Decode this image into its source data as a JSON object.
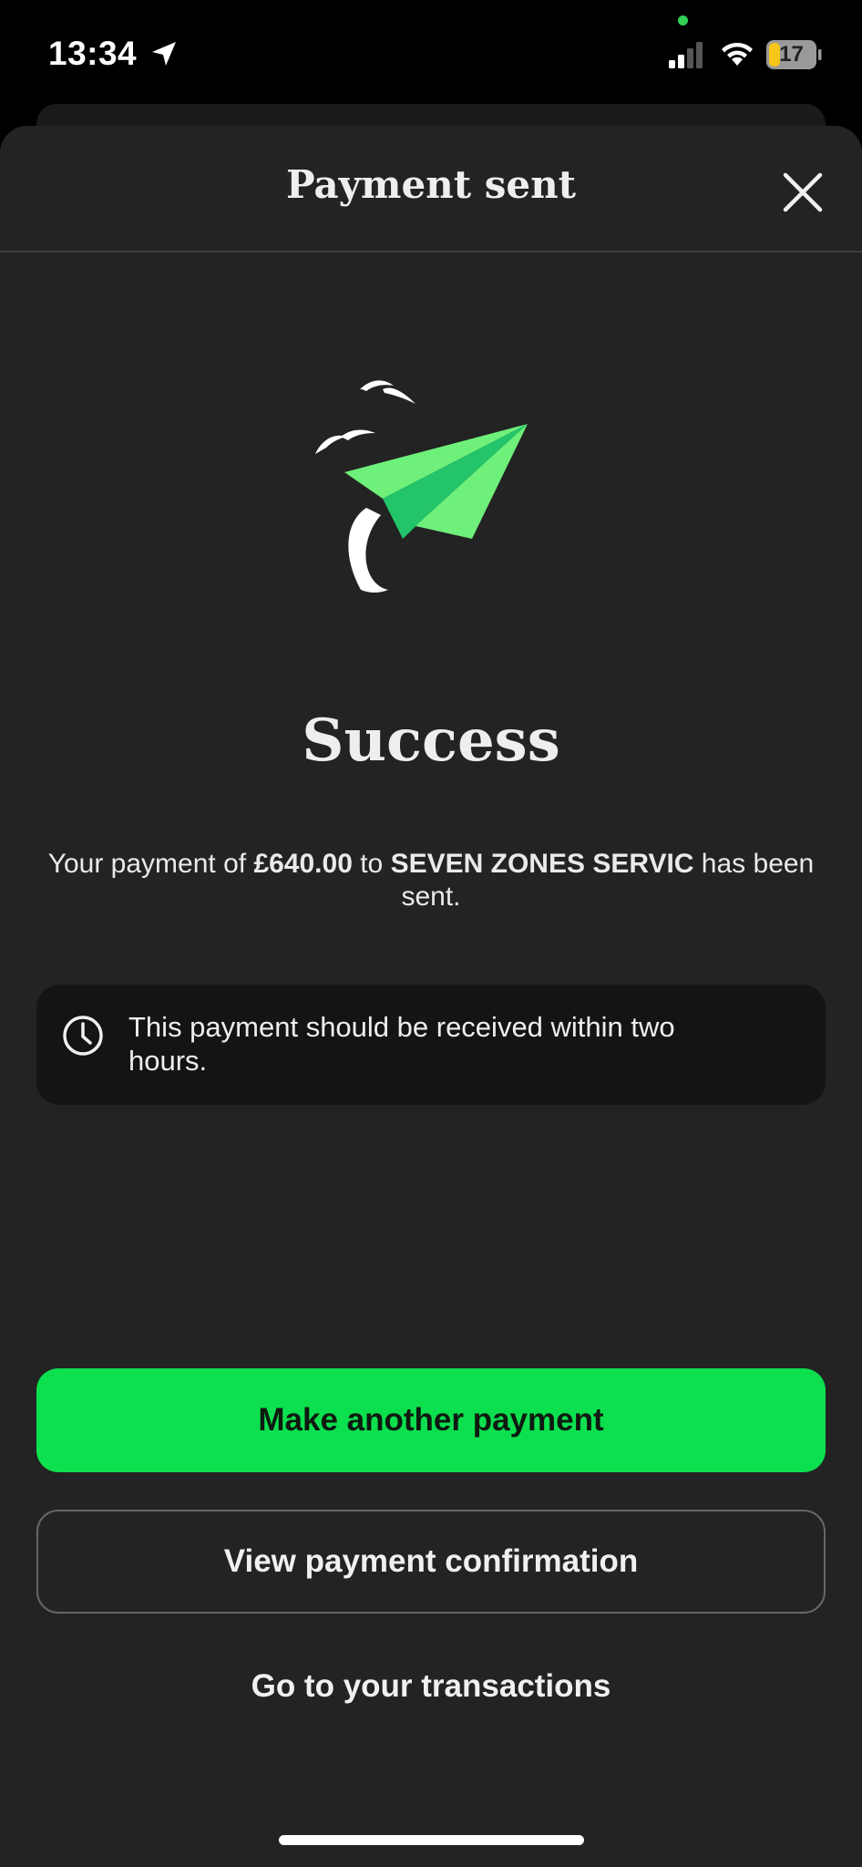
{
  "status_bar": {
    "time": "13:34",
    "battery": "17",
    "icons": [
      "location-arrow-icon",
      "signal-icon",
      "wifi-icon",
      "battery-icon"
    ]
  },
  "header": {
    "title": "Payment sent",
    "close_icon": "close-icon"
  },
  "illustration": {
    "icon": "paper-plane-icon",
    "colors": {
      "plane_light": "#6ef07a",
      "plane_mid": "#23c46a",
      "plane_dark": "#0f6b3a"
    }
  },
  "main": {
    "heading": "Success",
    "message": {
      "prefix": "Your payment of ",
      "amount": "£640.00",
      "middle": " to ",
      "payee": "SEVEN ZONES SERVIC",
      "suffix": " has been sent."
    },
    "info": {
      "icon": "clock-icon",
      "text": "This payment should be received within two hours."
    }
  },
  "actions": {
    "primary_label": "Make another payment",
    "secondary_label": "View payment confirmation",
    "link_label": "Go to your transactions"
  },
  "colors": {
    "accent": "#0ce04f",
    "sheet_background": "#232323",
    "info_background": "#141414"
  }
}
